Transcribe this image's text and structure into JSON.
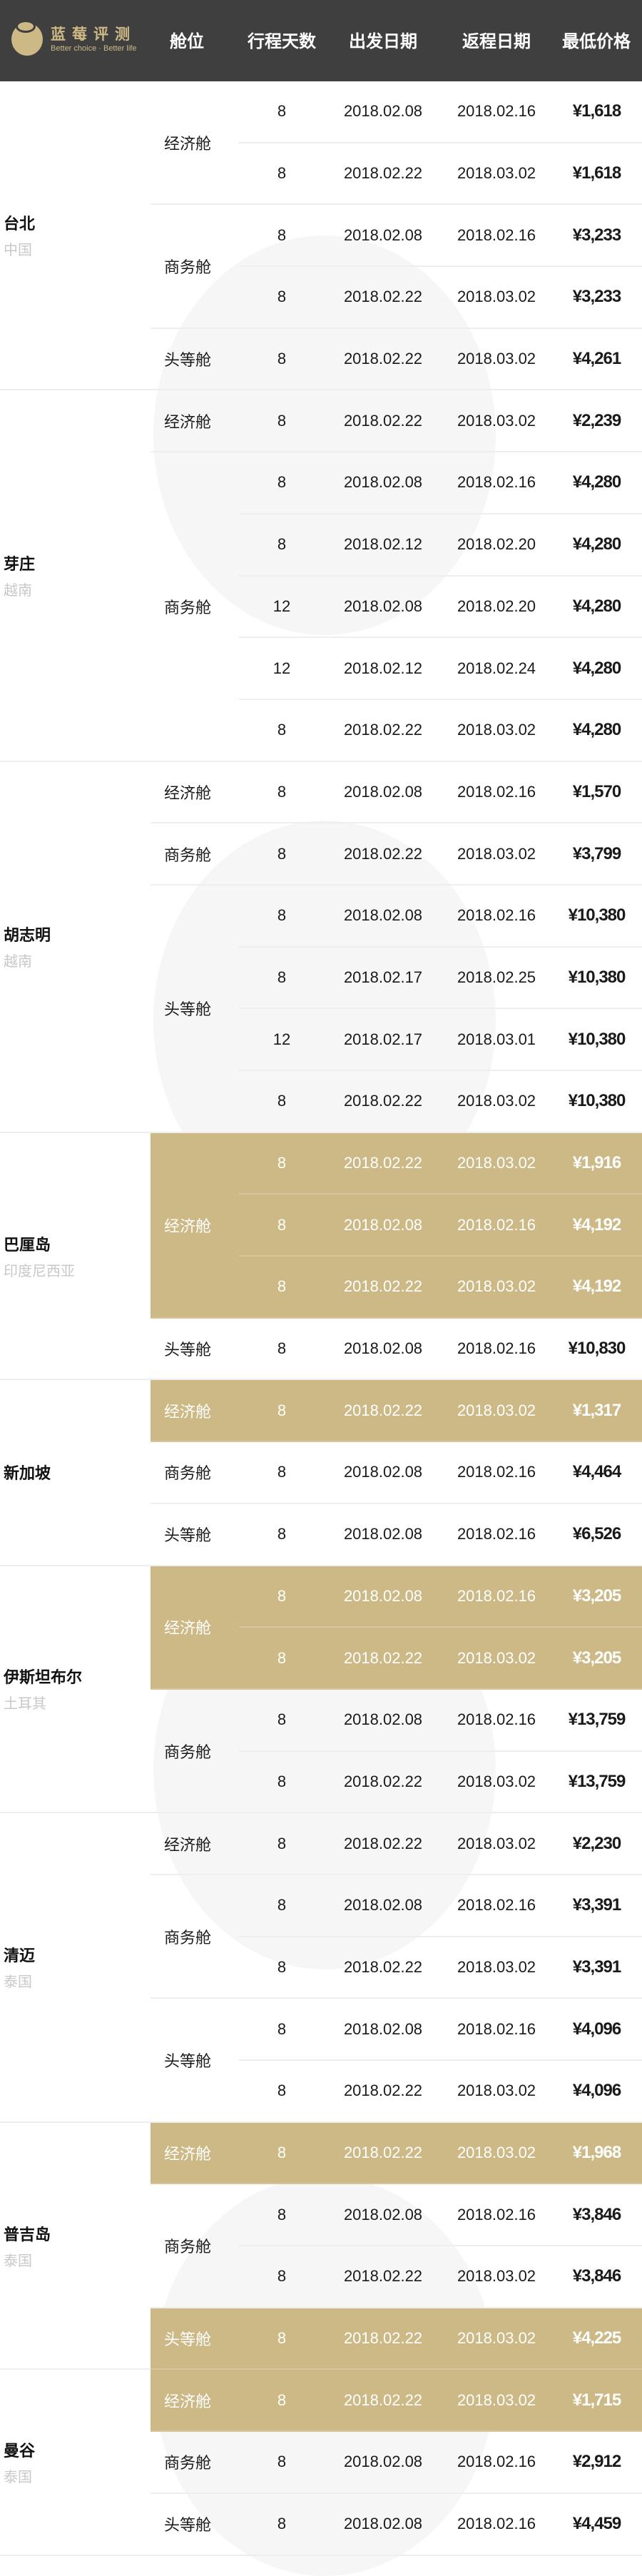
{
  "header": {
    "logo_cn": "蓝莓评测",
    "logo_en": "Better choice · Better life",
    "columns": [
      "舱位",
      "行程天数",
      "出发日期",
      "返程日期",
      "最低价格"
    ]
  },
  "colors": {
    "header_bg": "#3f3f3f",
    "accent": "#cdb985"
  },
  "cities": [
    {
      "name": "台北",
      "country": "中国",
      "groups": [
        {
          "cabin": "经济舱",
          "highlight": false,
          "rows": [
            [
              "8",
              "2018.02.08",
              "2018.02.16",
              "¥1,618"
            ],
            [
              "8",
              "2018.02.22",
              "2018.03.02",
              "¥1,618"
            ]
          ]
        },
        {
          "cabin": "商务舱",
          "highlight": false,
          "rows": [
            [
              "8",
              "2018.02.08",
              "2018.02.16",
              "¥3,233"
            ],
            [
              "8",
              "2018.02.22",
              "2018.03.02",
              "¥3,233"
            ]
          ]
        },
        {
          "cabin": "头等舱",
          "highlight": false,
          "rows": [
            [
              "8",
              "2018.02.22",
              "2018.03.02",
              "¥4,261"
            ]
          ]
        }
      ]
    },
    {
      "name": "芽庄",
      "country": "越南",
      "groups": [
        {
          "cabin": "经济舱",
          "highlight": false,
          "rows": [
            [
              "8",
              "2018.02.22",
              "2018.03.02",
              "¥2,239"
            ]
          ]
        },
        {
          "cabin": "商务舱",
          "highlight": false,
          "rows": [
            [
              "8",
              "2018.02.08",
              "2018.02.16",
              "¥4,280"
            ],
            [
              "8",
              "2018.02.12",
              "2018.02.20",
              "¥4,280"
            ],
            [
              "12",
              "2018.02.08",
              "2018.02.20",
              "¥4,280"
            ],
            [
              "12",
              "2018.02.12",
              "2018.02.24",
              "¥4,280"
            ],
            [
              "8",
              "2018.02.22",
              "2018.03.02",
              "¥4,280"
            ]
          ]
        }
      ]
    },
    {
      "name": "胡志明",
      "country": "越南",
      "groups": [
        {
          "cabin": "经济舱",
          "highlight": false,
          "rows": [
            [
              "8",
              "2018.02.08",
              "2018.02.16",
              "¥1,570"
            ]
          ]
        },
        {
          "cabin": "商务舱",
          "highlight": false,
          "rows": [
            [
              "8",
              "2018.02.22",
              "2018.03.02",
              "¥3,799"
            ]
          ]
        },
        {
          "cabin": "头等舱",
          "highlight": false,
          "rows": [
            [
              "8",
              "2018.02.08",
              "2018.02.16",
              "¥10,380"
            ],
            [
              "8",
              "2018.02.17",
              "2018.02.25",
              "¥10,380"
            ],
            [
              "12",
              "2018.02.17",
              "2018.03.01",
              "¥10,380"
            ],
            [
              "8",
              "2018.02.22",
              "2018.03.02",
              "¥10,380"
            ]
          ]
        }
      ]
    },
    {
      "name": "巴厘岛",
      "country": "印度尼西亚",
      "groups": [
        {
          "cabin": "经济舱",
          "highlight": true,
          "rows": [
            [
              "8",
              "2018.02.22",
              "2018.03.02",
              "¥1,916"
            ],
            [
              "8",
              "2018.02.08",
              "2018.02.16",
              "¥4,192"
            ],
            [
              "8",
              "2018.02.22",
              "2018.03.02",
              "¥4,192"
            ]
          ]
        },
        {
          "cabin": "头等舱",
          "highlight": false,
          "rows": [
            [
              "8",
              "2018.02.08",
              "2018.02.16",
              "¥10,830"
            ]
          ]
        }
      ]
    },
    {
      "name": "新加坡",
      "country": "",
      "groups": [
        {
          "cabin": "经济舱",
          "highlight": true,
          "rows": [
            [
              "8",
              "2018.02.22",
              "2018.03.02",
              "¥1,317"
            ]
          ]
        },
        {
          "cabin": "商务舱",
          "highlight": false,
          "rows": [
            [
              "8",
              "2018.02.08",
              "2018.02.16",
              "¥4,464"
            ]
          ]
        },
        {
          "cabin": "头等舱",
          "highlight": false,
          "rows": [
            [
              "8",
              "2018.02.08",
              "2018.02.16",
              "¥6,526"
            ]
          ]
        }
      ]
    },
    {
      "name": "伊斯坦布尔",
      "country": "土耳其",
      "groups": [
        {
          "cabin": "经济舱",
          "highlight": true,
          "rows": [
            [
              "8",
              "2018.02.08",
              "2018.02.16",
              "¥3,205"
            ],
            [
              "8",
              "2018.02.22",
              "2018.03.02",
              "¥3,205"
            ]
          ]
        },
        {
          "cabin": "商务舱",
          "highlight": false,
          "rows": [
            [
              "8",
              "2018.02.08",
              "2018.02.16",
              "¥13,759"
            ],
            [
              "8",
              "2018.02.22",
              "2018.03.02",
              "¥13,759"
            ]
          ]
        }
      ]
    },
    {
      "name": "清迈",
      "country": "泰国",
      "groups": [
        {
          "cabin": "经济舱",
          "highlight": false,
          "rows": [
            [
              "8",
              "2018.02.22",
              "2018.03.02",
              "¥2,230"
            ]
          ]
        },
        {
          "cabin": "商务舱",
          "highlight": false,
          "rows": [
            [
              "8",
              "2018.02.08",
              "2018.02.16",
              "¥3,391"
            ],
            [
              "8",
              "2018.02.22",
              "2018.03.02",
              "¥3,391"
            ]
          ]
        },
        {
          "cabin": "头等舱",
          "highlight": false,
          "rows": [
            [
              "8",
              "2018.02.08",
              "2018.02.16",
              "¥4,096"
            ],
            [
              "8",
              "2018.02.22",
              "2018.03.02",
              "¥4,096"
            ]
          ]
        }
      ]
    },
    {
      "name": "普吉岛",
      "country": "泰国",
      "groups": [
        {
          "cabin": "经济舱",
          "highlight": true,
          "rows": [
            [
              "8",
              "2018.02.22",
              "2018.03.02",
              "¥1,968"
            ]
          ]
        },
        {
          "cabin": "商务舱",
          "highlight": false,
          "rows": [
            [
              "8",
              "2018.02.08",
              "2018.02.16",
              "¥3,846"
            ],
            [
              "8",
              "2018.02.22",
              "2018.03.02",
              "¥3,846"
            ]
          ]
        },
        {
          "cabin": "头等舱",
          "highlight": true,
          "rows": [
            [
              "8",
              "2018.02.22",
              "2018.03.02",
              "¥4,225"
            ]
          ]
        }
      ]
    },
    {
      "name": "曼谷",
      "country": "泰国",
      "groups": [
        {
          "cabin": "经济舱",
          "highlight": true,
          "rows": [
            [
              "8",
              "2018.02.22",
              "2018.03.02",
              "¥1,715"
            ]
          ]
        },
        {
          "cabin": "商务舱",
          "highlight": false,
          "rows": [
            [
              "8",
              "2018.02.08",
              "2018.02.16",
              "¥2,912"
            ]
          ]
        },
        {
          "cabin": "头等舱",
          "highlight": false,
          "rows": [
            [
              "8",
              "2018.02.08",
              "2018.02.16",
              "¥4,459"
            ]
          ]
        }
      ]
    }
  ]
}
